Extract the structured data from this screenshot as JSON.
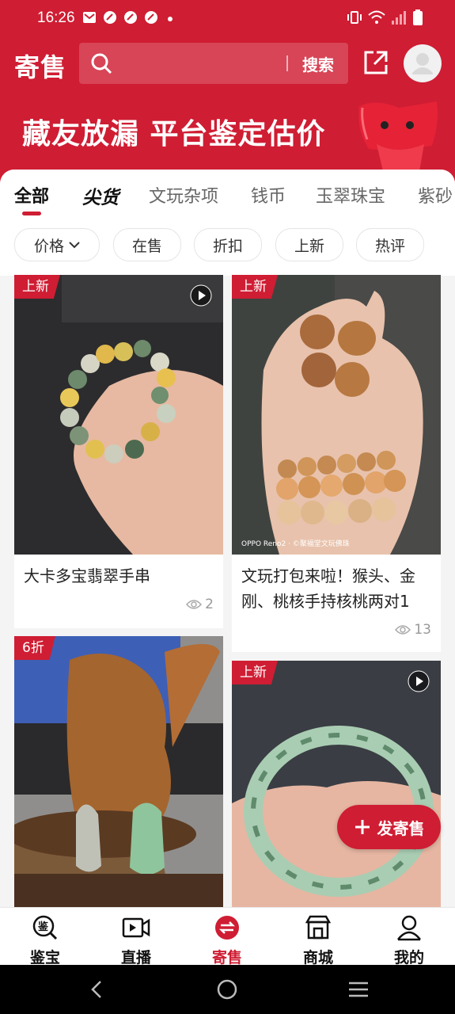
{
  "status_bar": {
    "time": "16:26"
  },
  "header": {
    "title": "寄售",
    "search_button": "搜索",
    "banner_text": "藏友放漏 平台鉴定估价"
  },
  "tabs": [
    {
      "label": "全部",
      "active": true
    },
    {
      "label": "尖货",
      "active": false
    },
    {
      "label": "文玩杂项",
      "active": false
    },
    {
      "label": "钱币",
      "active": false
    },
    {
      "label": "玉翠珠宝",
      "active": false
    },
    {
      "label": "紫砂",
      "active": false
    }
  ],
  "filters": [
    "价格",
    "在售",
    "折扣",
    "上新",
    "热评"
  ],
  "cards": [
    {
      "tag": "上新",
      "title": "大卡多宝翡翠手串",
      "views": "2",
      "video": true
    },
    {
      "tag": "上新",
      "title": "文玩打包来啦！猴头、金刚、桃核手持核桃两对1",
      "views": "13",
      "video": false,
      "watermark": "OPPO Reno2 · ©聚福堂文玩佛珠"
    },
    {
      "tag": "6折",
      "title": "",
      "views": "",
      "video": false
    },
    {
      "tag": "上新",
      "title": "",
      "views": "",
      "video": true
    }
  ],
  "fab": {
    "label": "发寄售"
  },
  "bottom_nav": [
    {
      "label": "鉴宝",
      "icon": "appraise-icon",
      "active": false
    },
    {
      "label": "直播",
      "icon": "live-icon",
      "active": false
    },
    {
      "label": "寄售",
      "icon": "consign-icon",
      "active": true
    },
    {
      "label": "商城",
      "icon": "mall-icon",
      "active": false
    },
    {
      "label": "我的",
      "icon": "profile-icon",
      "active": false
    }
  ],
  "colors": {
    "brand": "#cf1d33"
  }
}
